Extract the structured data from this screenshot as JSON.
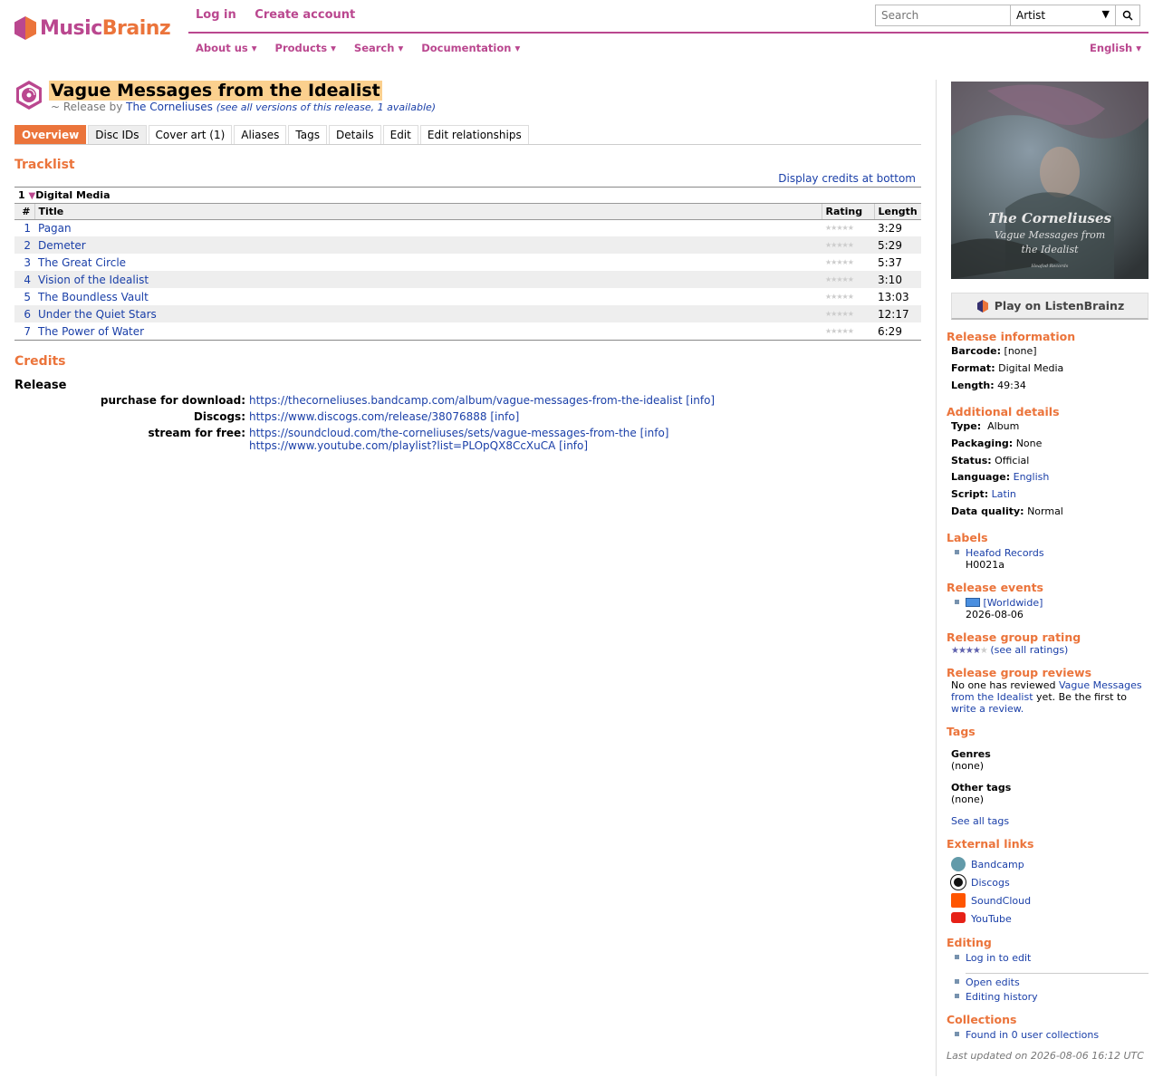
{
  "header": {
    "logo_music": "Music",
    "logo_brainz": "Brainz",
    "login": "Log in",
    "create_account": "Create account",
    "menu": [
      "About us ▾",
      "Products ▾",
      "Search ▾",
      "Documentation ▾"
    ],
    "language": "English ▾",
    "search_placeholder": "Search",
    "search_type": "Artist"
  },
  "release": {
    "title": "Vague Messages from the Idealist",
    "sub_prefix": "~ Release by",
    "artist": "The Corneliuses",
    "see_all": "(see all versions of this release, 1 available)"
  },
  "tabs": [
    "Overview",
    "Disc IDs",
    "Cover art (1)",
    "Aliases",
    "Tags",
    "Details",
    "Edit",
    "Edit relationships"
  ],
  "tracklist": {
    "heading": "Tracklist",
    "display_credits": "Display credits at bottom",
    "medium_num": "1",
    "medium_name": "Digital Media",
    "col_num": "#",
    "col_title": "Title",
    "col_rating": "Rating",
    "col_length": "Length",
    "tracks": [
      {
        "num": "1",
        "title": "Pagan",
        "length": "3:29"
      },
      {
        "num": "2",
        "title": "Demeter",
        "length": "5:29"
      },
      {
        "num": "3",
        "title": "The Great Circle",
        "length": "5:37"
      },
      {
        "num": "4",
        "title": "Vision of the Idealist",
        "length": "3:10"
      },
      {
        "num": "5",
        "title": "The Boundless Vault",
        "length": "13:03"
      },
      {
        "num": "6",
        "title": "Under the Quiet Stars",
        "length": "12:17"
      },
      {
        "num": "7",
        "title": "The Power of Water",
        "length": "6:29"
      }
    ]
  },
  "credits": {
    "heading": "Credits",
    "release_label": "Release",
    "purchase_label": "purchase for download:",
    "purchase_url": "https://thecorneliuses.bandcamp.com/album/vague-messages-from-the-idealist",
    "discogs_label": "Discogs:",
    "discogs_url": "https://www.discogs.com/release/38076888",
    "stream_label": "stream for free:",
    "stream_url1": "https://soundcloud.com/the-corneliuses/sets/vague-messages-from-the",
    "stream_url2": "https://www.youtube.com/playlist?list=PLOpQX8CcXuCA",
    "info": "[info]"
  },
  "sidebar": {
    "cover_artist": "The Corneliuses",
    "cover_title1": "Vague Messages from",
    "cover_title2": "the Idealist",
    "cover_label": "Heafod Records",
    "listenbrainz": "Play on ListenBrainz",
    "release_info_heading": "Release information",
    "barcode_label": "Barcode:",
    "barcode": "[none]",
    "format_label": "Format:",
    "format": "Digital Media",
    "length_label": "Length:",
    "length": "49:34",
    "additional_heading": "Additional details",
    "type_label": "Type:",
    "type": "Album",
    "packaging_label": "Packaging:",
    "packaging": "None",
    "status_label": "Status:",
    "status": "Official",
    "language_label": "Language:",
    "language": "English",
    "script_label": "Script:",
    "script": "Latin",
    "dq_label": "Data quality:",
    "dq": "Normal",
    "labels_heading": "Labels",
    "label_name": "Heafod Records",
    "catno": "H0021a",
    "events_heading": "Release events",
    "event_country": "[Worldwide]",
    "event_date": "2026-08-06",
    "rg_rating_heading": "Release group rating",
    "rg_rating_stars": "★★★★★",
    "rg_rating_fraction": 0.8,
    "see_all_ratings": "(see all ratings)",
    "reviews_heading": "Release group reviews",
    "reviews_1": "No one has reviewed",
    "reviews_title1": "Vague Messages",
    "reviews_title2": "from the Idealist",
    "reviews_2": "yet. Be the first to",
    "write_review": "write a review.",
    "tags_heading": "Tags",
    "genres_label": "Genres",
    "genres": "(none)",
    "other_tags_label": "Other tags",
    "other_tags": "(none)",
    "see_all_tags": "See all tags",
    "ext_heading": "External links",
    "ext": [
      "Bandcamp",
      "Discogs",
      "SoundCloud",
      "YouTube"
    ],
    "editing_heading": "Editing",
    "log_in_to_edit": "Log in to edit",
    "open_edits": "Open edits",
    "editing_history": "Editing history",
    "collections_heading": "Collections",
    "collections": "Found in 0 user collections",
    "last_updated": "Last updated on 2026-08-06 16:12 UTC"
  },
  "colors": {
    "orange": "#eb743b",
    "purple": "#ba478f",
    "link": "#1a3fa8"
  }
}
